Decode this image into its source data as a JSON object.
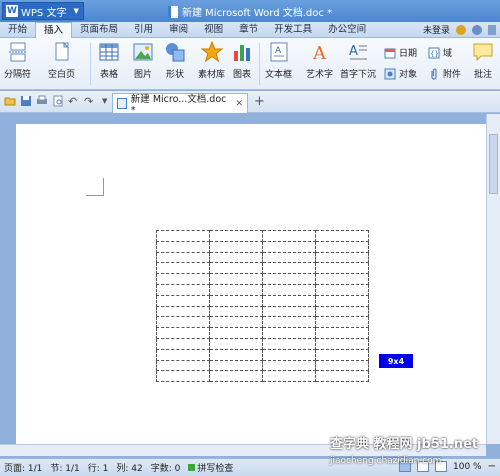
{
  "titlebar": {
    "app_button": "WPS 文字",
    "doc_title": "新建 Microsoft Word 文档.doc *"
  },
  "menu": {
    "items": [
      "开始",
      "插入",
      "页面布局",
      "引用",
      "审阅",
      "视图",
      "章节",
      "开发工具",
      "办公空间"
    ],
    "active": "插入",
    "login": "未登录"
  },
  "ribbon": {
    "page_break": "分隔符",
    "blank_page": "空白页",
    "table": "表格",
    "picture": "图片",
    "shape": "形状",
    "clipart": "素材库",
    "chart": "图表",
    "textbox": "文本框",
    "wordart": "艺术字",
    "dropcap": "首字下沉",
    "date": "日期",
    "object": "对象",
    "field": "域",
    "attachment": "附件",
    "comment": "批注"
  },
  "tabs": {
    "doc_tab": "新建 Micro...文档.doc *",
    "add": "+"
  },
  "document": {
    "table_rows": 14,
    "table_cols": 4,
    "insert_hint": "9x4"
  },
  "status": {
    "page": "页面: 1/1",
    "section": "节: 1/1",
    "line": "行: 1",
    "column": "列: 42",
    "words": "字数: 0",
    "spell": "拼写检查",
    "zoom": "100 %"
  },
  "watermark": {
    "line1": "查字典 教程网 jb51.net",
    "line2": "jiaocheng.chazidian.com"
  }
}
